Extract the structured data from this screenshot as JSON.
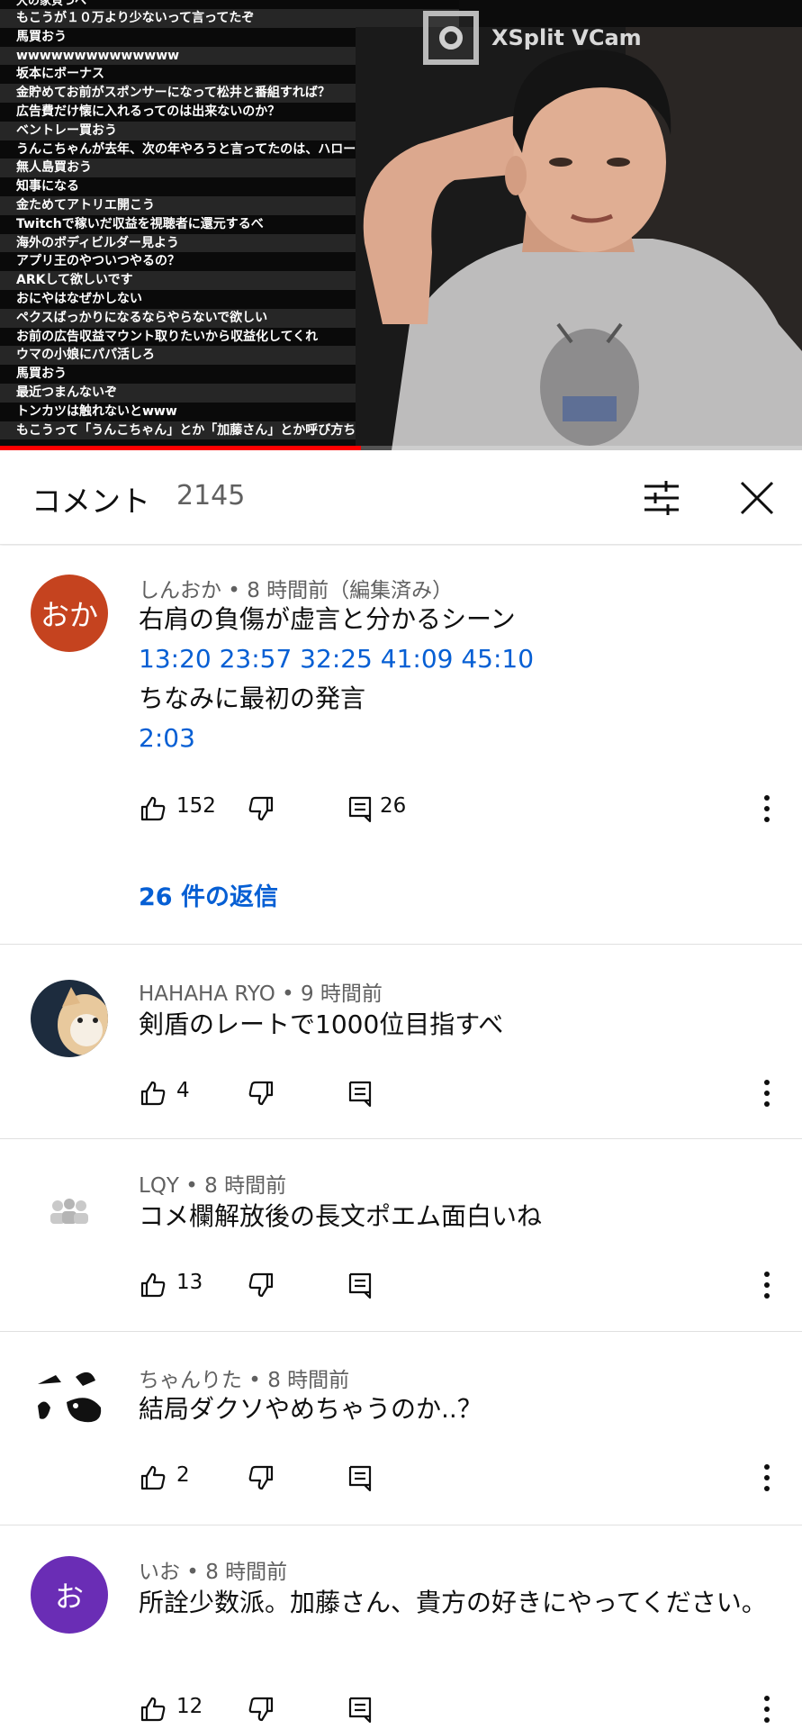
{
  "video": {
    "chat_lines": [
      "大の家貝つへ",
      "もこうが１０万より少ないって言ってたぞ",
      "馬買おう",
      "wwwwwwwwwwwwww",
      "坂本にボーナス",
      "金貯めてお前がスポンサーになって松井と番組すれば？",
      "広告費だけ懐に入れるってのは出来ないのか？",
      "ベントレー買おう",
      "うんこちゃんが去年、次の年やろうと言ってたのは、ハローネ",
      "無人島買おう",
      "知事になる",
      "金ためてアトリエ開こう",
      "Twitchで稼いだ収益を視聴者に還元するべ",
      "海外のボディビルダー見よう",
      "アプリ王のやついつやるの？",
      "ARKして欲しいです",
      "おにやはなぜかしない",
      "ペクスばっかりになるならやらないで欲しい",
      "お前の広告収益マウント取りたいから収益化してくれ",
      "ウマの小娘にパパ活しろ",
      "馬買おう",
      "最近つまんないぞ",
      "トンカツは触れないとwww",
      "もこうって「うんこちゃん」とか「加藤さん」とか呼び方ちやふやだけ"
    ],
    "overlay_brand": "XSplit VCam",
    "progress": 0.45
  },
  "header": {
    "title": "コメント",
    "count": "2145"
  },
  "comments": [
    {
      "author_meta": "しんおか • 8 時間前（編集済み）",
      "avatar_text": "おか",
      "avatar_color": "#c5431f",
      "line1": "右肩の負傷が虚言と分かるシーン",
      "timestamps": "13:20  23:57 32:25 41:09 45:10",
      "line2": "ちなみに最初の発言",
      "timestamp2": "2:03",
      "likes": "152",
      "reply_count": "26",
      "replies_label": "26 件の返信"
    },
    {
      "author_meta": "HAHAHA RYO • 9 時間前",
      "text": "剣盾のレートで1000位目指すべ",
      "likes": "4"
    },
    {
      "author_meta": "LQY • 8 時間前",
      "text": "コメ欄解放後の長文ポエム面白いね",
      "likes": "13"
    },
    {
      "author_meta": "ちゃんりた • 8 時間前",
      "text": "結局ダクソやめちゃうのか..？",
      "likes": "2"
    },
    {
      "author_meta": "いお • 8 時間前",
      "avatar_text": "お",
      "avatar_color": "#6a2db5",
      "text": "所詮少数派。加藤さん、貴方の好きにやってください。",
      "likes": "12"
    }
  ]
}
